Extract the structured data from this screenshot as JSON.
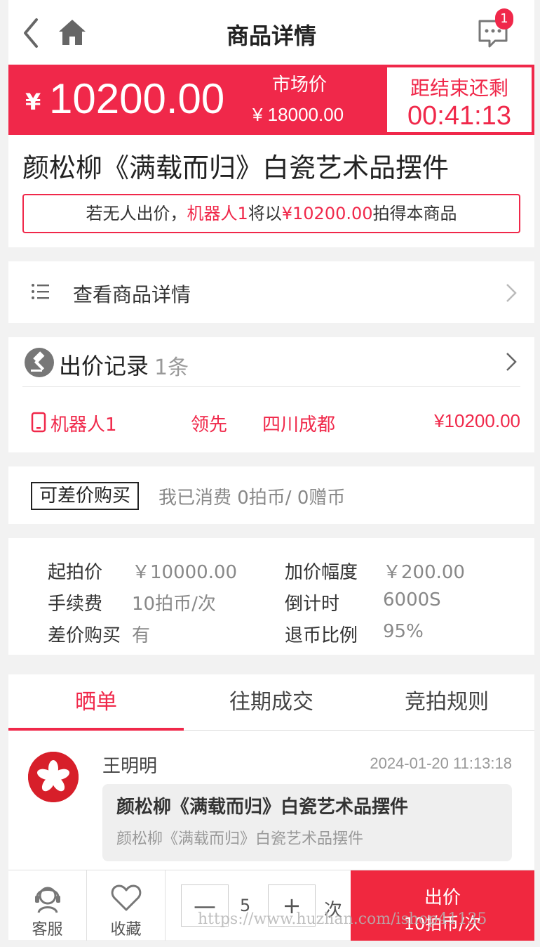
{
  "header": {
    "title": "商品详情",
    "message_badge": "1"
  },
  "price_bar": {
    "currency": "¥",
    "current_price": "10200.00",
    "market_label": "市场价",
    "market_price": "¥ 18000.00",
    "countdown_label": "距结束还剩",
    "countdown": "00:41:13",
    "accent_color": "#f0284a"
  },
  "product": {
    "name": "颜松柳《满载而归》白瓷艺术品摆件",
    "notice_prefix": "若无人出价，",
    "notice_bidder": "机器人1",
    "notice_mid": "将以",
    "notice_price": "¥10200.00",
    "notice_suffix": "拍得本商品"
  },
  "detail_link": {
    "label": "查看商品详情",
    "icon": "list-icon"
  },
  "bids": {
    "title": "出价记录",
    "count": "1条",
    "rows": [
      {
        "bidder": "机器人1",
        "status": "领先",
        "location": "四川成都",
        "amount": "¥10200.00",
        "device_icon": "phone-icon"
      }
    ]
  },
  "diff_purchase": {
    "tag": "可差价购买",
    "info": "我已消费 0拍币/ 0赠币"
  },
  "info": {
    "start_price_label": "起拍价",
    "start_price": "￥10000.00",
    "increment_label": "加价幅度",
    "increment": "￥200.00",
    "fee_label": "手续费",
    "fee": "10拍币/次",
    "countdown_label": "倒计时",
    "countdown": "6000S",
    "diff_label": "差价购买",
    "diff": "有",
    "refund_label": "退币比例",
    "refund": "95%"
  },
  "tabs": [
    "晒单",
    "往期成交",
    "竞拍规则"
  ],
  "review": {
    "user": "王明明",
    "time": "2024-01-20 11:13:18",
    "card_title": "颜松柳《满载而归》白瓷艺术品摆件",
    "card_sub": "颜松柳《满载而归》白瓷艺术品摆件"
  },
  "bottom": {
    "service_label": "客服",
    "favorite_label": "收藏",
    "minus": "—",
    "quantity": "5",
    "plus": "+",
    "unit": "次",
    "bid_label": "出价",
    "bid_cost": "10拍币/次"
  },
  "watermark": "https://www.huzhan.com/ishop41135"
}
